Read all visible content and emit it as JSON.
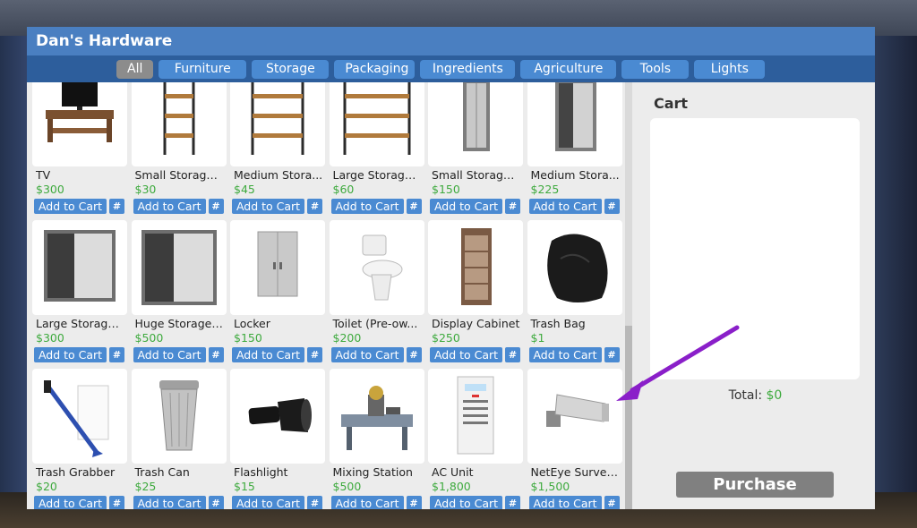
{
  "window": {
    "title": "Dan's Hardware"
  },
  "tabs": [
    {
      "label": "All",
      "active": true
    },
    {
      "label": "Furniture"
    },
    {
      "label": "Storage"
    },
    {
      "label": "Packaging"
    },
    {
      "label": "Ingredients"
    },
    {
      "label": "Agriculture"
    },
    {
      "label": "Tools"
    },
    {
      "label": "Lights"
    }
  ],
  "items": [
    {
      "name": "TV",
      "price": "$300",
      "icon": "tv-icon"
    },
    {
      "name": "Small Storage ...",
      "price": "$30",
      "icon": "small-shelf-icon"
    },
    {
      "name": "Medium Stora...",
      "price": "$45",
      "icon": "medium-shelf-icon"
    },
    {
      "name": "Large Storage ...",
      "price": "$60",
      "icon": "large-shelf-icon"
    },
    {
      "name": "Small Storage ...",
      "price": "$150",
      "icon": "small-closet-icon"
    },
    {
      "name": "Medium Stora...",
      "price": "$225",
      "icon": "medium-closet-icon"
    },
    {
      "name": "Large Storage ...",
      "price": "$300",
      "icon": "large-closet-icon"
    },
    {
      "name": "Huge Storage ...",
      "price": "$500",
      "icon": "huge-closet-icon"
    },
    {
      "name": "Locker",
      "price": "$150",
      "icon": "locker-icon"
    },
    {
      "name": "Toilet (Pre-ow...",
      "price": "$200",
      "icon": "toilet-icon"
    },
    {
      "name": "Display Cabinet",
      "price": "$250",
      "icon": "display-cabinet-icon"
    },
    {
      "name": "Trash Bag",
      "price": "$1",
      "icon": "trash-bag-icon"
    },
    {
      "name": "Trash Grabber",
      "price": "$20",
      "icon": "trash-grabber-icon"
    },
    {
      "name": "Trash Can",
      "price": "$25",
      "icon": "trash-can-icon"
    },
    {
      "name": "Flashlight",
      "price": "$15",
      "icon": "flashlight-icon"
    },
    {
      "name": "Mixing Station",
      "price": "$500",
      "icon": "mixing-station-icon"
    },
    {
      "name": "AC Unit",
      "price": "$1,800",
      "icon": "ac-unit-icon"
    },
    {
      "name": "NetEye Surveil...",
      "price": "$1,500",
      "icon": "security-camera-icon"
    }
  ],
  "item_buttons": {
    "add_label": "Add to Cart",
    "hash_label": "#"
  },
  "cart": {
    "title": "Cart",
    "total_label": "Total:",
    "total_value": "$0",
    "purchase_label": "Purchase"
  },
  "colors": {
    "titlebar": "#4a7fc1",
    "tabbar": "#2d5e9c",
    "button": "#4a8ad2",
    "price": "#3eaa3e",
    "annotation_arrow": "#8a1fc9"
  },
  "annotation": {
    "type": "arrow",
    "points_to": "security-camera-item"
  }
}
